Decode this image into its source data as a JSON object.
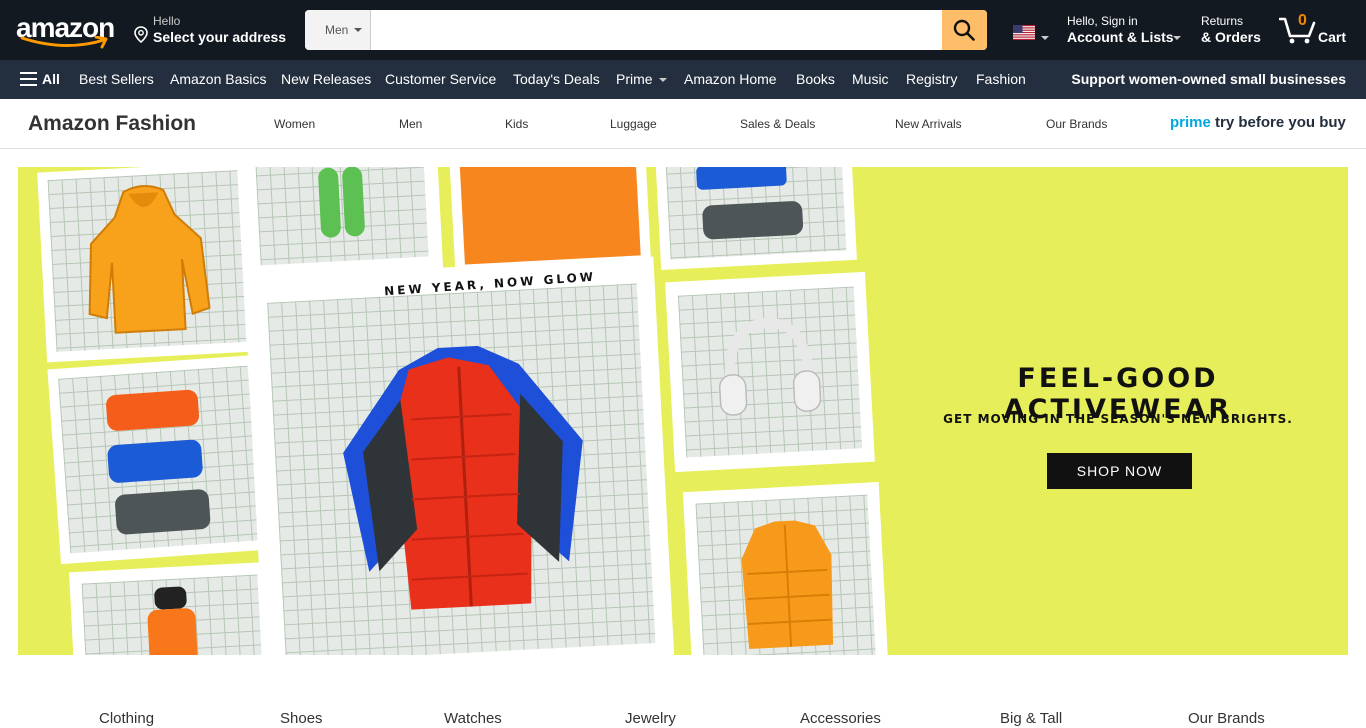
{
  "header": {
    "logo_text": "amazon",
    "deliver_line1": "Hello",
    "deliver_line2": "Select your address",
    "search_category": "Men",
    "search_placeholder": "",
    "account_line1": "Hello, Sign in",
    "account_line2": "Account & Lists",
    "returns_line1": "Returns",
    "returns_line2": "& Orders",
    "cart_count": "0",
    "cart_label": "Cart"
  },
  "nav": {
    "all_label": "All",
    "items": [
      "Best Sellers",
      "Amazon Basics",
      "New Releases",
      "Customer Service",
      "Today's Deals",
      "Prime",
      "Amazon Home",
      "Books",
      "Music",
      "Registry",
      "Fashion"
    ],
    "promo": "Support women-owned small businesses"
  },
  "subnav": {
    "brand": "Amazon Fashion",
    "items": [
      "Women",
      "Men",
      "Kids",
      "Luggage",
      "Sales & Deals",
      "New Arrivals",
      "Our Brands"
    ],
    "prime_word": "prime",
    "prime_tag": "try before you buy"
  },
  "hero": {
    "tagline": "NEW YEAR, NOW GLOW",
    "title": "FEEL-GOOD ACTIVEWEAR",
    "subtitle": "GET MOVING IN THE SEASON'S NEW BRIGHTS.",
    "cta": "SHOP NOW",
    "colors": {
      "background": "#e6ef5a",
      "accent_orange": "#ff9900",
      "cta_bg": "#111111"
    }
  },
  "categories": [
    "Clothing",
    "Shoes",
    "Watches",
    "Jewelry",
    "Accessories",
    "Big & Tall",
    "Our Brands"
  ]
}
